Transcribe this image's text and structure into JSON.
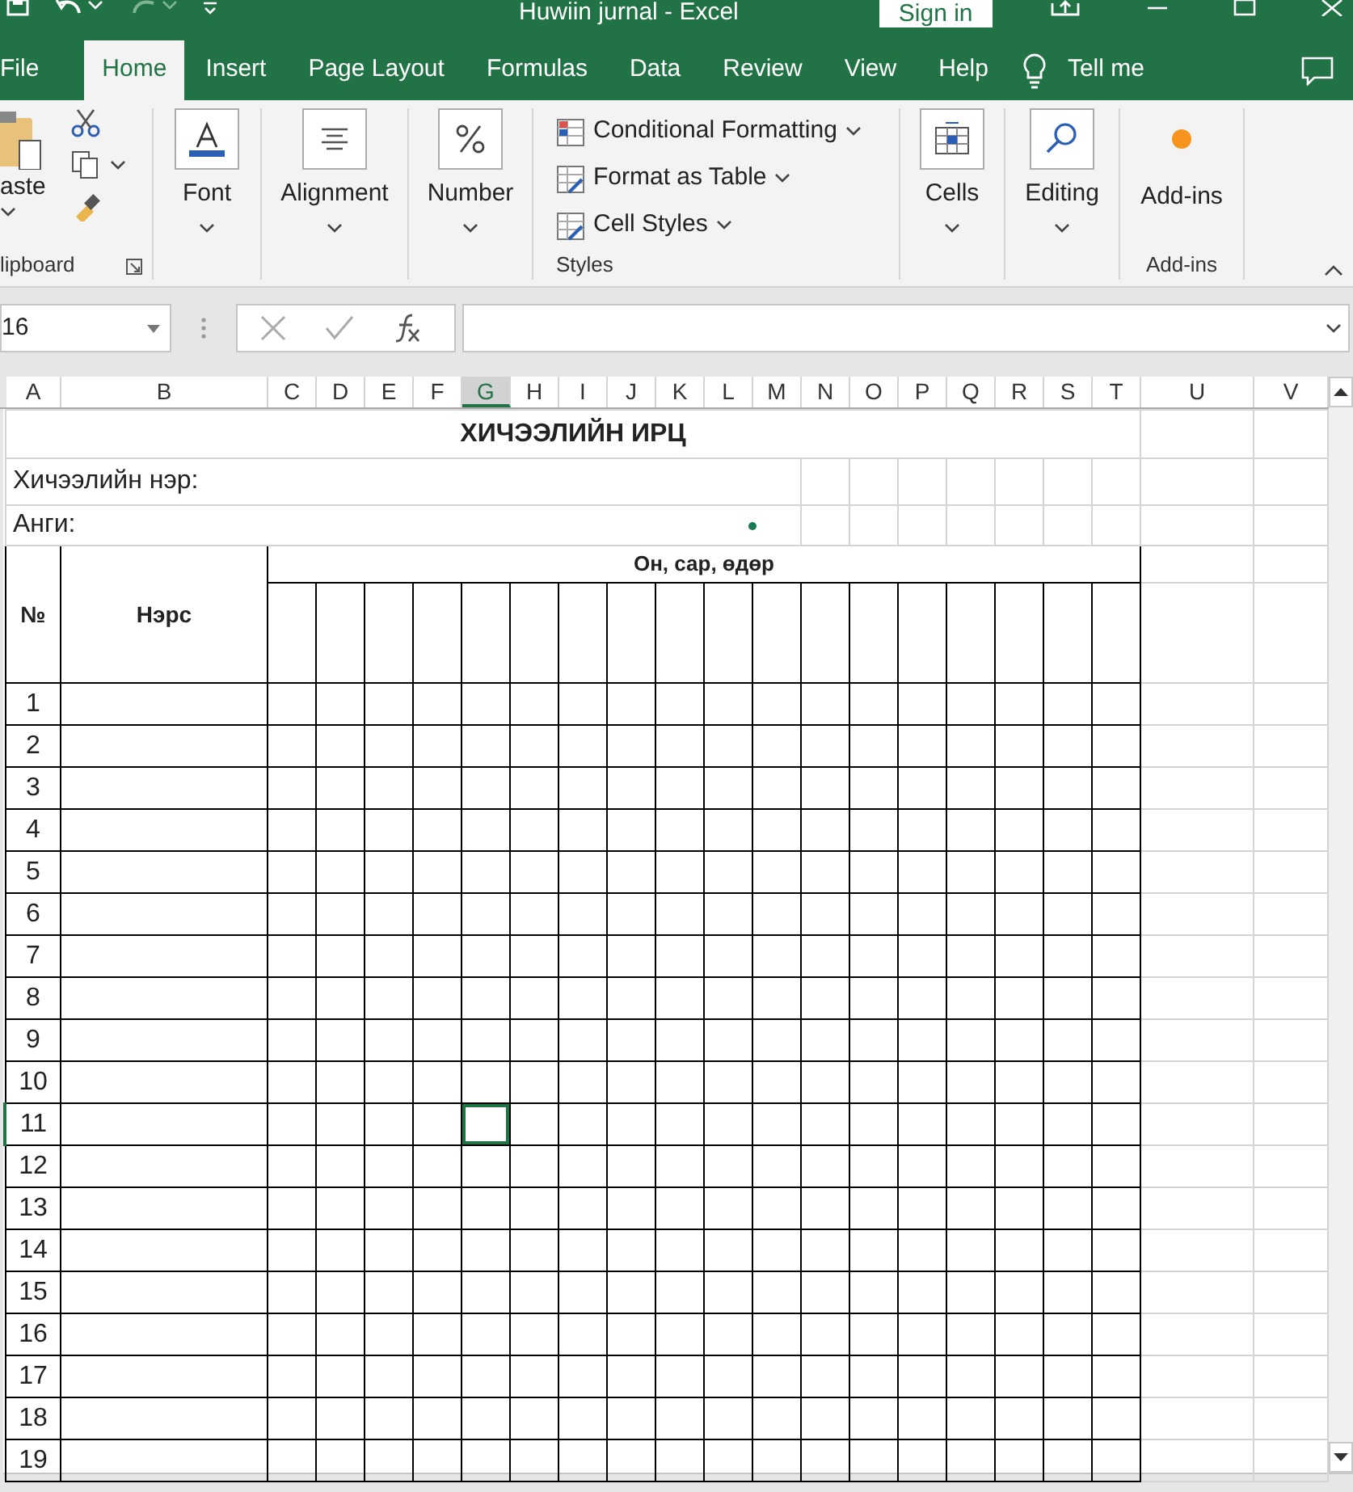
{
  "window": {
    "title": "Huwiin jurnal  -  Excel",
    "sign_in": "Sign in"
  },
  "ribbon_tabs": [
    {
      "label": "File",
      "selected": false
    },
    {
      "label": "Home",
      "selected": true
    },
    {
      "label": "Insert",
      "selected": false
    },
    {
      "label": "Page Layout",
      "selected": false
    },
    {
      "label": "Formulas",
      "selected": false
    },
    {
      "label": "Data",
      "selected": false
    },
    {
      "label": "Review",
      "selected": false
    },
    {
      "label": "View",
      "selected": false
    },
    {
      "label": "Help",
      "selected": false
    }
  ],
  "tell_me": "Tell me",
  "ribbon_groups": [
    {
      "kind": "clipboard",
      "button": "aste",
      "label": "lipboard"
    },
    {
      "kind": "big",
      "button": "Font"
    },
    {
      "kind": "big",
      "button": "Alignment"
    },
    {
      "kind": "big",
      "button": "Number"
    },
    {
      "kind": "list",
      "items": [
        "Conditional Formatting",
        "Format as Table",
        "Cell Styles"
      ],
      "label": "Styles"
    },
    {
      "kind": "big",
      "button": "Cells"
    },
    {
      "kind": "big",
      "button": "Editing"
    },
    {
      "kind": "plain",
      "button": "Add-ins",
      "label": "Add-ins"
    }
  ],
  "formula_bar": {
    "name_box": "16"
  },
  "columns": [
    {
      "label": "A",
      "selected": false
    },
    {
      "label": "B",
      "selected": false
    },
    {
      "label": "C",
      "selected": false
    },
    {
      "label": "D",
      "selected": false
    },
    {
      "label": "E",
      "selected": false
    },
    {
      "label": "F",
      "selected": false
    },
    {
      "label": "G",
      "selected": true
    },
    {
      "label": "H",
      "selected": false
    },
    {
      "label": "I",
      "selected": false
    },
    {
      "label": "J",
      "selected": false
    },
    {
      "label": "K",
      "selected": false
    },
    {
      "label": "L",
      "selected": false
    },
    {
      "label": "M",
      "selected": false
    },
    {
      "label": "N",
      "selected": false
    },
    {
      "label": "O",
      "selected": false
    },
    {
      "label": "P",
      "selected": false
    },
    {
      "label": "Q",
      "selected": false
    },
    {
      "label": "R",
      "selected": false
    },
    {
      "label": "S",
      "selected": false
    },
    {
      "label": "T",
      "selected": false
    },
    {
      "label": "U",
      "selected": false
    },
    {
      "label": "V",
      "selected": false
    }
  ],
  "sheet": {
    "title": "ХИЧЭЭЛИЙН ИРЦ",
    "lesson_label": "Хичээлийн нэр:",
    "class_label": "Анги:",
    "header": {
      "number": "№",
      "name": "Нэрс",
      "date": "Он, сар, өдөр"
    },
    "rows": [
      {
        "number": "1",
        "selected": false
      },
      {
        "number": "2",
        "selected": false
      },
      {
        "number": "3",
        "selected": false
      },
      {
        "number": "4",
        "selected": false
      },
      {
        "number": "5",
        "selected": false
      },
      {
        "number": "6",
        "selected": false
      },
      {
        "number": "7",
        "selected": false
      },
      {
        "number": "8",
        "selected": false
      },
      {
        "number": "9",
        "selected": false
      },
      {
        "number": "10",
        "selected": false
      },
      {
        "number": "11",
        "selected": true
      },
      {
        "number": "12",
        "selected": false
      },
      {
        "number": "13",
        "selected": false
      },
      {
        "number": "14",
        "selected": false
      },
      {
        "number": "15",
        "selected": false
      },
      {
        "number": "16",
        "selected": false
      },
      {
        "number": "17",
        "selected": false
      },
      {
        "number": "18",
        "selected": false
      },
      {
        "number": "19",
        "selected": false
      }
    ]
  }
}
